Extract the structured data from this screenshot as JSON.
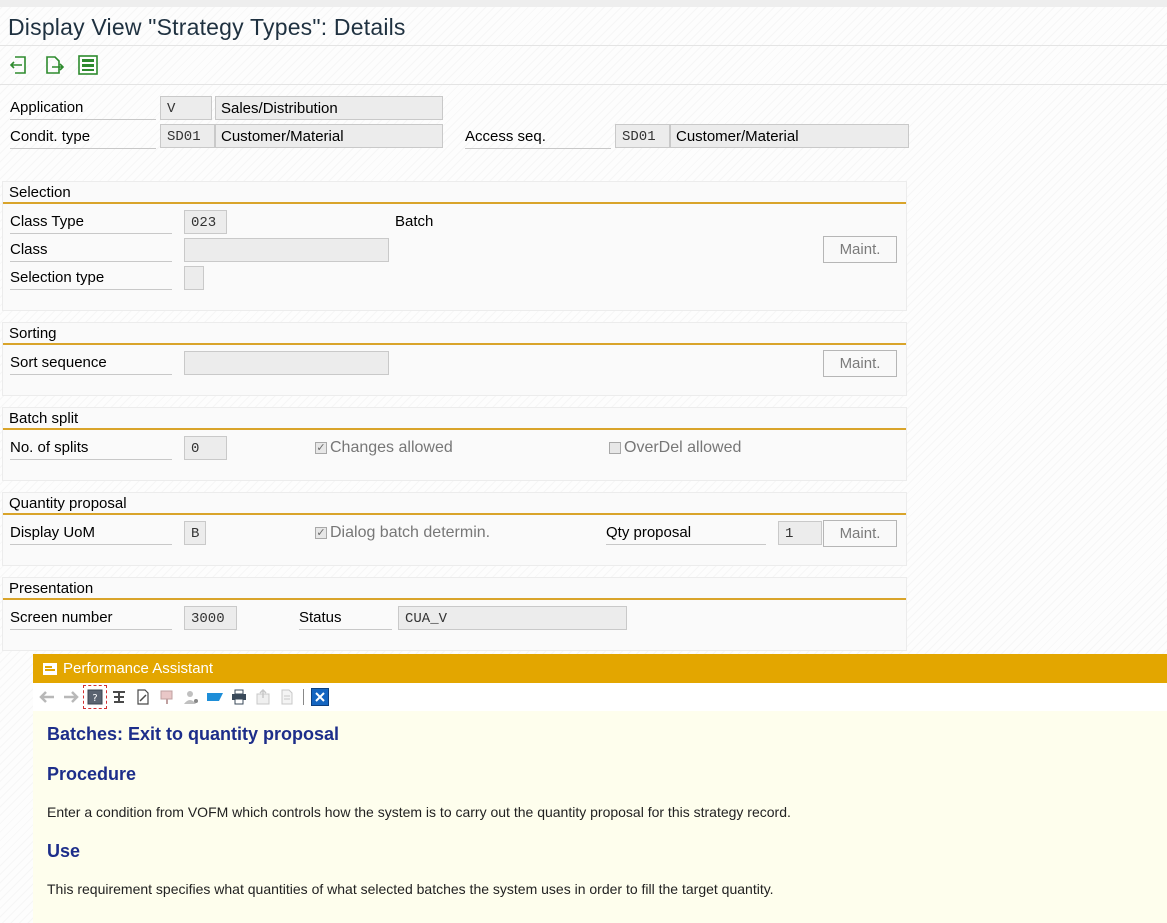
{
  "window": {
    "title": "Display View \"Strategy Types\": Details"
  },
  "toolbar": {
    "icons": [
      "previous-entry-icon",
      "next-entry-icon",
      "select-icon"
    ]
  },
  "header": {
    "application_label": "Application",
    "application_code": "V",
    "application_desc": "Sales/Distribution",
    "condit_type_label": "Condit. type",
    "condit_type_code": "SD01",
    "condit_type_desc": "Customer/Material",
    "access_seq_label": "Access seq.",
    "access_seq_code": "SD01",
    "access_seq_desc": "Customer/Material"
  },
  "selection": {
    "title": "Selection",
    "class_type_label": "Class Type",
    "class_type_value": "023",
    "class_type_desc": "Batch",
    "class_label": "Class",
    "class_value": "",
    "selection_type_label": "Selection type",
    "selection_type_value": "",
    "maint_label": "Maint."
  },
  "sorting": {
    "title": "Sorting",
    "sort_sequence_label": "Sort sequence",
    "sort_sequence_value": "",
    "maint_label": "Maint."
  },
  "batch_split": {
    "title": "Batch split",
    "splits_label": "No. of splits",
    "splits_value": "0",
    "changes_allowed_label": "Changes allowed",
    "changes_allowed_checked": true,
    "overdel_allowed_label": "OverDel allowed",
    "overdel_allowed_checked": false
  },
  "quantity_proposal": {
    "title": "Quantity proposal",
    "display_uom_label": "Display UoM",
    "display_uom_value": "B",
    "dialog_batch_label": "Dialog batch determin.",
    "dialog_batch_checked": true,
    "qty_proposal_label": "Qty proposal",
    "qty_proposal_value": "1",
    "maint_label": "Maint."
  },
  "presentation": {
    "title": "Presentation",
    "screen_number_label": "Screen number",
    "screen_number_value": "3000",
    "status_label": "Status",
    "status_value": "CUA_V"
  },
  "performance_assistant": {
    "title": "Performance Assistant",
    "heading": "Batches: Exit to quantity proposal",
    "procedure_heading": "Procedure",
    "procedure_text": "Enter a condition from VOFM which controls how the system is to carry out the quantity proposal for this strategy record.",
    "use_heading": "Use",
    "use_text": "This requirement specifies what quantities of what selected batches the system uses in order to fill the target quantity."
  },
  "colors": {
    "group_underline": "#d9a42a",
    "pa_title_bar": "#e3a600",
    "pa_body_bg": "#fefeed",
    "pa_heading": "#1d2e8a"
  }
}
